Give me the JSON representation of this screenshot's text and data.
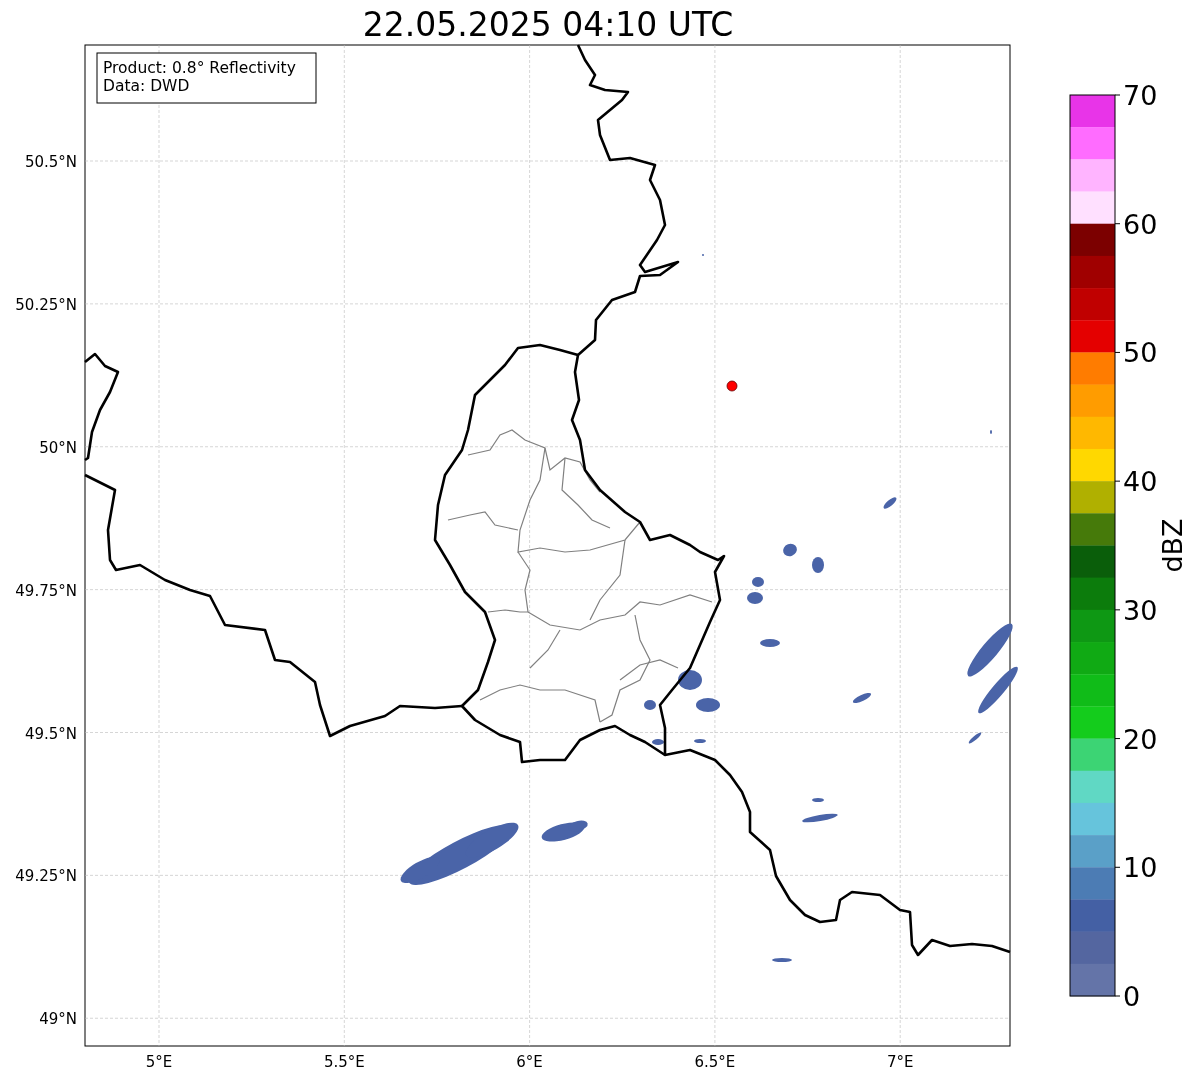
{
  "title": "22.05.2025 04:10 UTC",
  "info_box": [
    "Product: 0.8° Reflectivity",
    "Data: DWD"
  ],
  "map": {
    "y_ticks": [
      "50.5°N",
      "50.25°N",
      "50°N",
      "49.75°N",
      "49.5°N",
      "49.25°N",
      "49°N"
    ],
    "x_ticks": [
      "5°E",
      "5.5°E",
      "6°E",
      "6.5°E",
      "7°E"
    ]
  },
  "colorbar": {
    "label": "dBZ",
    "ticks": [
      "70",
      "60",
      "50",
      "40",
      "30",
      "20",
      "10",
      "0"
    ],
    "bands": [
      {
        "color": "#e834e8"
      },
      {
        "color": "#ff6cff"
      },
      {
        "color": "#ffb4ff"
      },
      {
        "color": "#ffe0ff"
      },
      {
        "color": "#7c0000"
      },
      {
        "color": "#a00000"
      },
      {
        "color": "#c00000"
      },
      {
        "color": "#e40000"
      },
      {
        "color": "#ff7c00"
      },
      {
        "color": "#ff9c00"
      },
      {
        "color": "#ffb800"
      },
      {
        "color": "#ffd800"
      },
      {
        "color": "#b0b000"
      },
      {
        "color": "#467a0a"
      },
      {
        "color": "#0a5e0a"
      },
      {
        "color": "#0c7c0c"
      },
      {
        "color": "#0e9814"
      },
      {
        "color": "#10aa14"
      },
      {
        "color": "#10bc18"
      },
      {
        "color": "#14cc1c"
      },
      {
        "color": "#3cd474"
      },
      {
        "color": "#60d8c4"
      },
      {
        "color": "#66c4dc"
      },
      {
        "color": "#5aa0c8"
      },
      {
        "color": "#4c7cb4"
      },
      {
        "color": "#4460a4"
      },
      {
        "color": "#5466a0"
      },
      {
        "color": "#6474a8"
      }
    ]
  }
}
